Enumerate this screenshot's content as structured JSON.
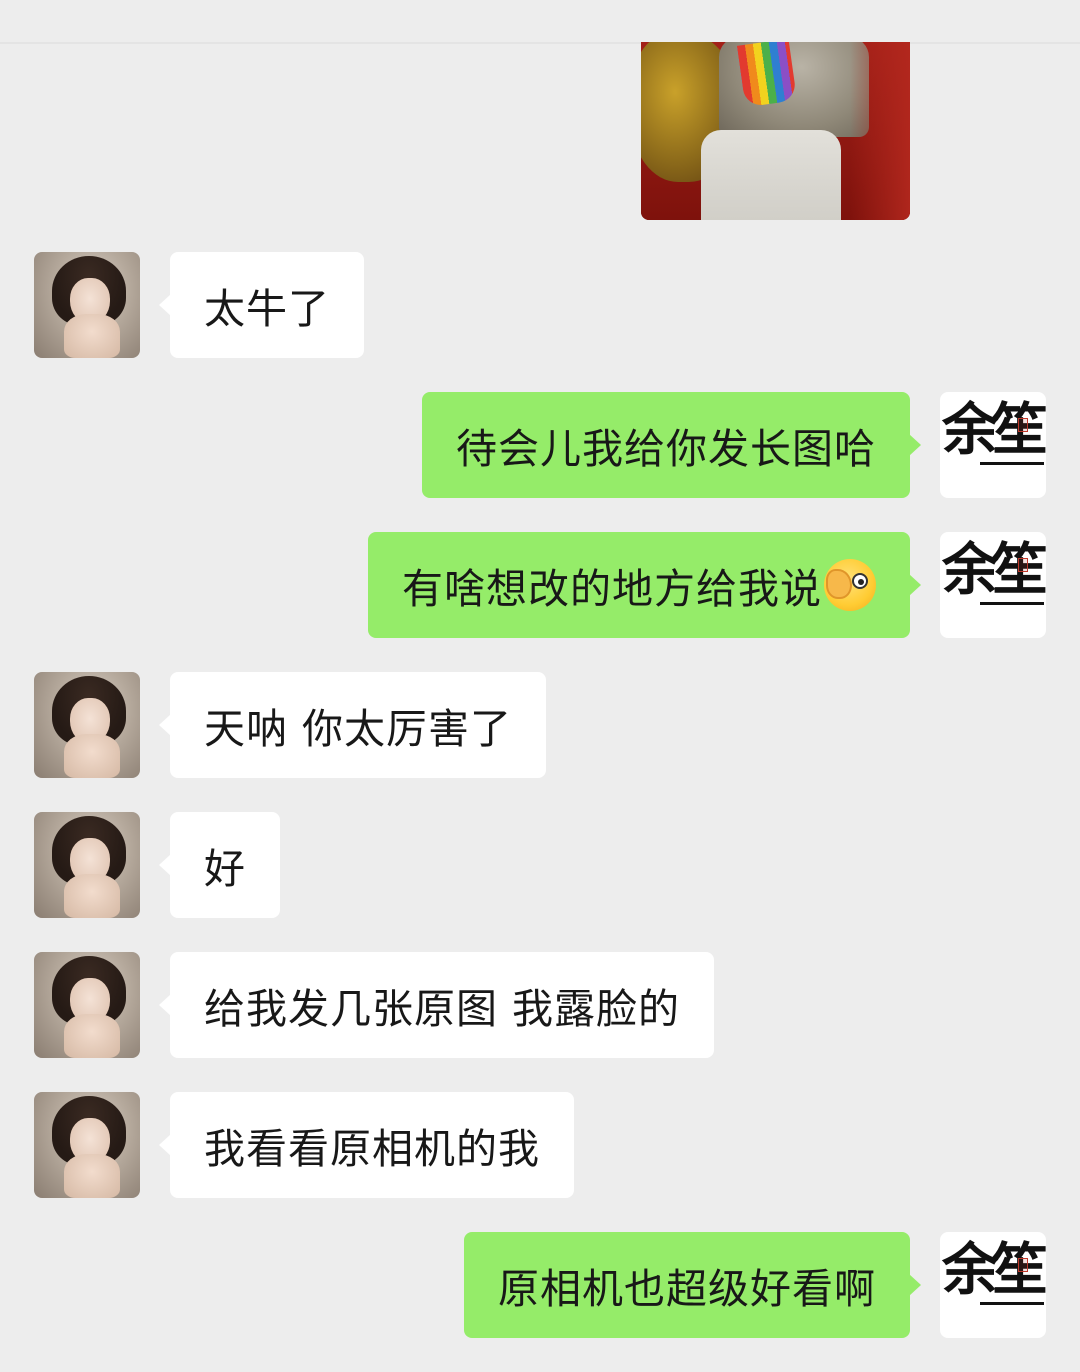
{
  "chat": {
    "messages": [
      {
        "sender": "other",
        "text": "太牛了"
      },
      {
        "sender": "self",
        "text": "待会儿我给你发长图哈"
      },
      {
        "sender": "self",
        "text": "有啥想改的地方给我说",
        "emoji": "face-with-hand-over-eye"
      },
      {
        "sender": "other",
        "text": "天呐 你太厉害了"
      },
      {
        "sender": "other",
        "text": "好"
      },
      {
        "sender": "other",
        "text": "给我发几张原图 我露脸的"
      },
      {
        "sender": "other",
        "text": "我看看原相机的我"
      },
      {
        "sender": "self",
        "text": "原相机也超级好看啊"
      }
    ]
  },
  "avatars": {
    "self_logo_text": "余笙"
  },
  "colors": {
    "background": "#ededed",
    "incoming_bubble": "#ffffff",
    "outgoing_bubble": "#95ec69"
  }
}
